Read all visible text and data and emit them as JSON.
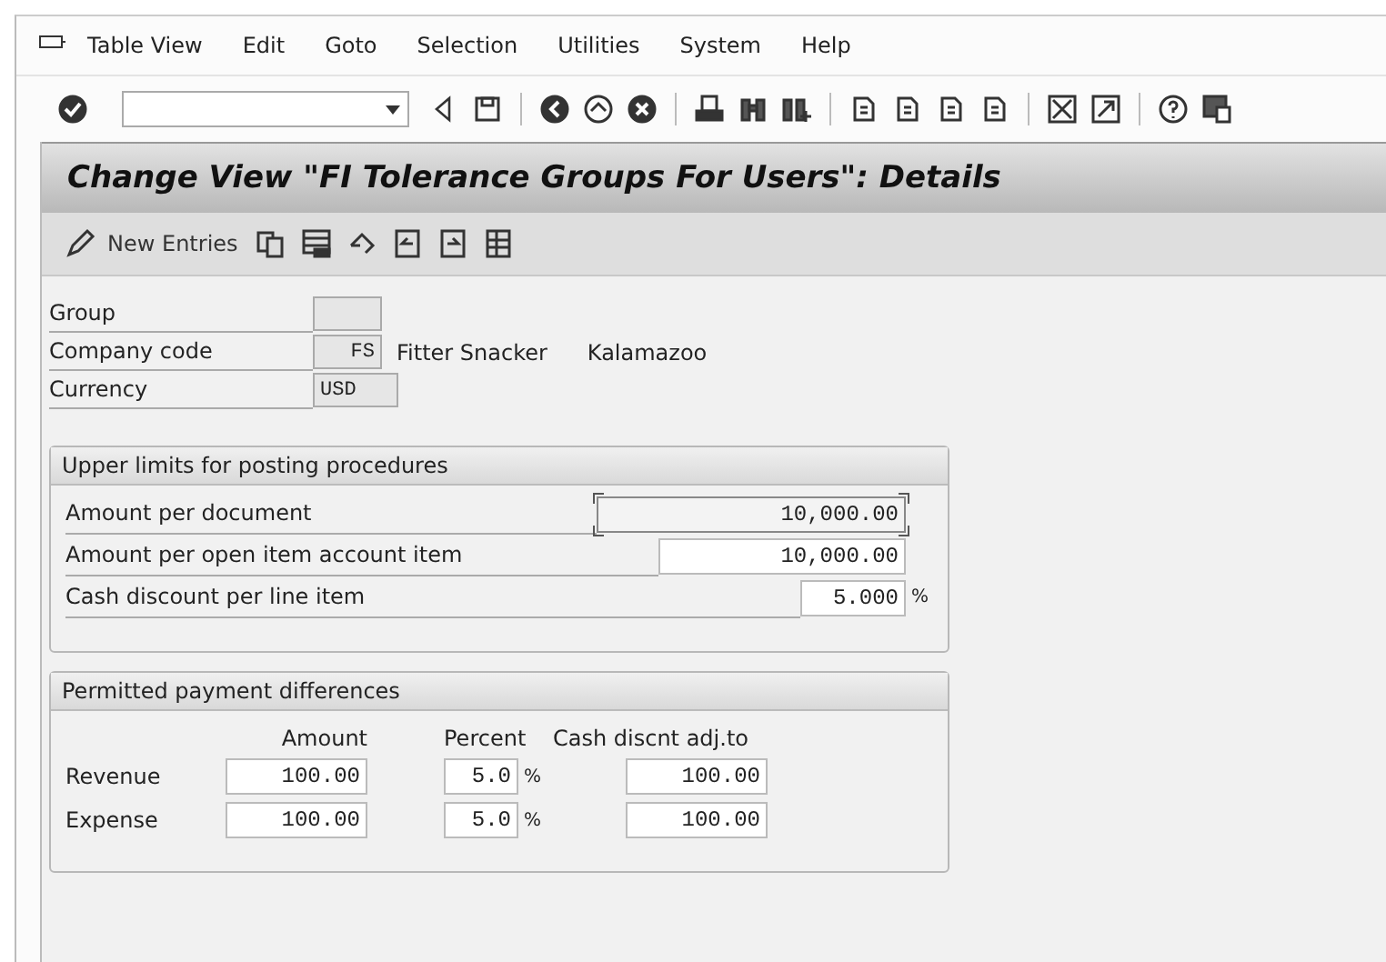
{
  "menu": [
    {
      "label": "Table View"
    },
    {
      "label": "Edit"
    },
    {
      "label": "Goto"
    },
    {
      "label": "Selection"
    },
    {
      "label": "Utilities"
    },
    {
      "label": "System"
    },
    {
      "label": "Help"
    }
  ],
  "title": "Change View \"FI Tolerance Groups For Users\": Details",
  "app_toolbar": {
    "new_entries": "New Entries"
  },
  "header_fields": [
    {
      "label": "Group"
    },
    {
      "label": "Company code",
      "value": "FS",
      "description": [
        "Fitter Snacker",
        "Kalamazoo"
      ]
    },
    {
      "label": "Currency",
      "value": "USD"
    }
  ],
  "upper_limits": {
    "title": "Upper limits for posting procedures",
    "rows": [
      {
        "label": "Amount per document",
        "value": "10,000.00",
        "focused": true
      },
      {
        "label": "Amount per open item account item",
        "value": "10,000.00",
        "focused": false
      },
      {
        "label": "Cash discount per line item",
        "value": "5.000",
        "unit": "%",
        "focused": false
      }
    ]
  },
  "payment_differences": {
    "title": "Permitted payment differences",
    "columns": [
      "Amount",
      "Percent",
      "Cash discnt adj.to"
    ],
    "rows": [
      {
        "label": "Revenue",
        "amount": "100.00",
        "percent": "5.0",
        "percent_unit": "%",
        "cash_discount": "100.00"
      },
      {
        "label": "Expense",
        "amount": "100.00",
        "percent": "5.0",
        "percent_unit": "%",
        "cash_discount": "100.00"
      }
    ]
  }
}
